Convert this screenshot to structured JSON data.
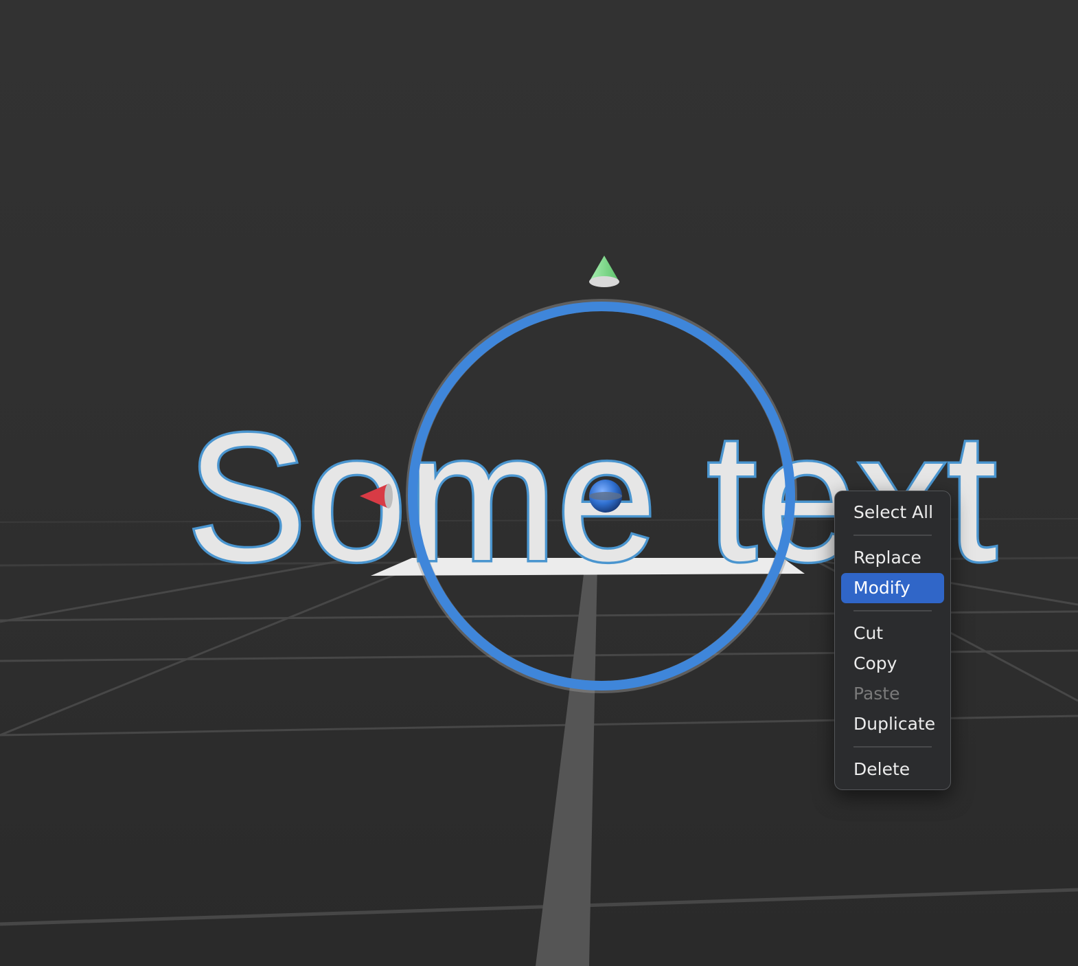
{
  "scene": {
    "text_object": "Some text",
    "gizmo_colors": {
      "y_axis": "#7fd88a",
      "x_axis": "#d83b45",
      "z_axis": "#2f6fcf",
      "rotation_ring": "#3f86da",
      "text_outline": "#4a95cf"
    }
  },
  "context_menu": {
    "items": [
      {
        "label": "Select All",
        "state": "normal"
      },
      {
        "separator": true
      },
      {
        "label": "Replace",
        "state": "normal"
      },
      {
        "label": "Modify",
        "state": "highlighted"
      },
      {
        "separator": true
      },
      {
        "label": "Cut",
        "state": "normal"
      },
      {
        "label": "Copy",
        "state": "normal"
      },
      {
        "label": "Paste",
        "state": "disabled"
      },
      {
        "label": "Duplicate",
        "state": "normal"
      },
      {
        "separator": true
      },
      {
        "label": "Delete",
        "state": "normal"
      }
    ]
  }
}
